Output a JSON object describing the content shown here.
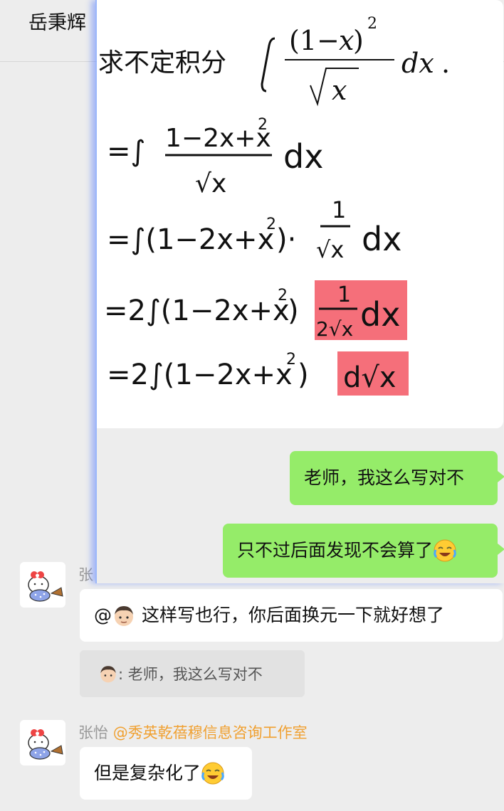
{
  "header": {
    "title": "岳秉辉"
  },
  "image": {
    "question": "求不定积分",
    "integral_expr": "∫ (1−x)² / √x dx .",
    "steps": [
      "= ∫ (1−2x+x²)/√x dx",
      "= ∫ (1−2x+x²) · 1/√x dx",
      "= 2∫ (1−2x+x²) 1/(2√x) dx",
      "= 2∫ (1−2x+x²) d√x"
    ]
  },
  "messages": [
    {
      "text": "老师，我这么写对不"
    },
    {
      "text": "只不过后面发现不会算了"
    }
  ],
  "reply": {
    "sender": "张",
    "mention": "@",
    "text": "这样写也行，你后面换元一下就好想了",
    "quote_text": ": 老师，我这么写对不"
  },
  "last": {
    "sender": "张怡",
    "mention": "@秀英乾蓓穆信息咨询工作室",
    "text": "但是复杂化了"
  }
}
